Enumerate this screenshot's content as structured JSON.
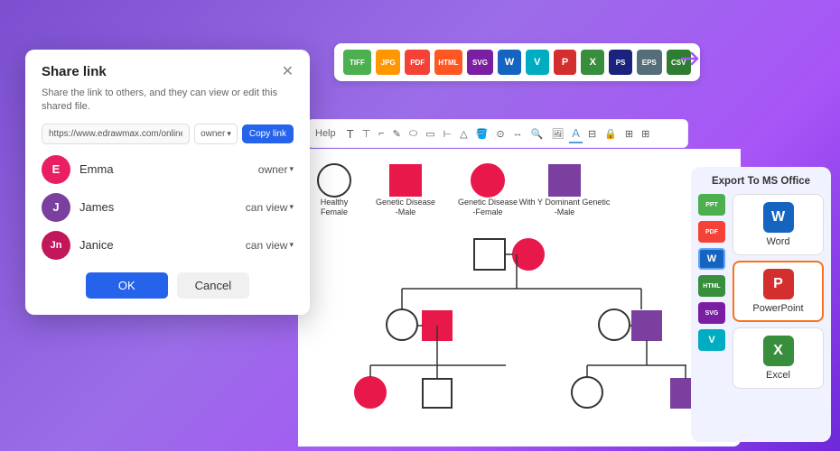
{
  "background": {
    "gradient": "linear-gradient(135deg, #7c4fd0, #a855f7)"
  },
  "export_toolbar": {
    "buttons": [
      {
        "label": "TIFF",
        "bg": "#4CAF50"
      },
      {
        "label": "JPG",
        "bg": "#FF9800"
      },
      {
        "label": "PDF",
        "bg": "#f44336"
      },
      {
        "label": "HTML",
        "bg": "#FF5722"
      },
      {
        "label": "SVG",
        "bg": "#9C27B0"
      },
      {
        "label": "W",
        "bg": "#2196F3"
      },
      {
        "label": "V",
        "bg": "#00BCD4"
      },
      {
        "label": "P",
        "bg": "#f44336"
      },
      {
        "label": "X",
        "bg": "#4CAF50"
      },
      {
        "label": "PS",
        "bg": "#1565C0"
      },
      {
        "label": "EPS",
        "bg": "#607D8B"
      },
      {
        "label": "CSV",
        "bg": "#4CAF50"
      }
    ]
  },
  "help_toolbar": {
    "label": "Help"
  },
  "legend": {
    "items": [
      {
        "label": "Healthy\nFemale",
        "shape": "circle",
        "color": "white"
      },
      {
        "label": "Genetic Disease\n-Male",
        "shape": "square",
        "color": "red"
      },
      {
        "label": "Genetic Disease\n-Female",
        "shape": "circle",
        "color": "red"
      },
      {
        "label": "With Y Dominant Genetic\n-Male",
        "shape": "square",
        "color": "purple"
      }
    ]
  },
  "export_panel": {
    "title": "Export To MS Office",
    "small_icons": [
      {
        "label": "PPT",
        "bg": "#4CAF50"
      },
      {
        "label": "PDF",
        "bg": "#f44336"
      },
      {
        "label": "W",
        "bg": "#2196F3"
      },
      {
        "label": "HTML",
        "bg": "#4CAF50"
      },
      {
        "label": "SVG",
        "bg": "#9C27B0"
      },
      {
        "label": "V",
        "bg": "#00BCD4"
      }
    ],
    "large_buttons": [
      {
        "label": "Word",
        "icon": "W",
        "bg": "#2196F3",
        "selected": false
      },
      {
        "label": "PowerPoint",
        "icon": "P",
        "bg": "#f44336",
        "selected": true
      },
      {
        "label": "Excel",
        "icon": "X",
        "bg": "#4CAF50",
        "selected": false
      }
    ]
  },
  "share_dialog": {
    "title": "Share link",
    "description": "Share the link to others, and they can view or edit this shared file.",
    "url": "https://www.edrawmax.com/online/fil",
    "url_placeholder": "https://www.edrawmax.com/online/fil",
    "owner_label": "owner",
    "copy_label": "Copy link",
    "users": [
      {
        "name": "Emma",
        "role": "owner",
        "avatar_color": "#e91e63",
        "avatar_text": "E"
      },
      {
        "name": "James",
        "role": "can view",
        "avatar_color": "#9c27b0",
        "avatar_text": "J"
      },
      {
        "name": "Janice",
        "role": "can view",
        "avatar_color": "#c2185b",
        "avatar_text": "Jn"
      }
    ],
    "ok_label": "OK",
    "cancel_label": "Cancel"
  }
}
